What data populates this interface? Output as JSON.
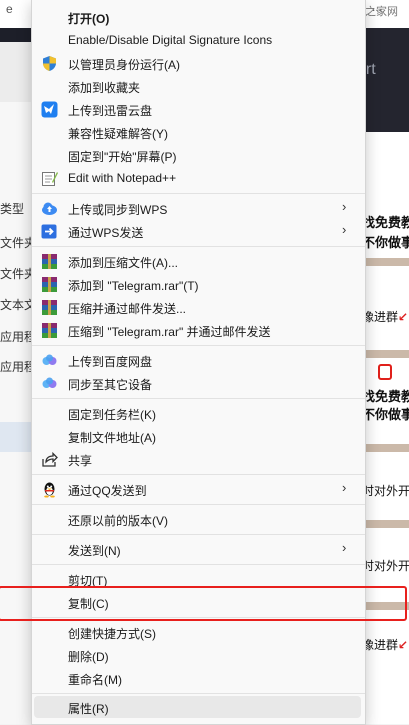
{
  "background": {
    "tab_ellipsis_1": "e",
    "tab_ellipsis_2": "...",
    "site_label": "才之家网",
    "dark_panel_text": "ort",
    "left_labels": [
      "类型",
      "文件夹",
      "文件夹",
      "文本文",
      "应用程",
      "应用程"
    ],
    "right_texts": [
      {
        "text": "找免费教",
        "bold": true
      },
      {
        "text": "不你做事",
        "bold": true
      },
      {
        "text": "像进群",
        "bold": false
      },
      {
        "text": "找免费教",
        "bold": true
      },
      {
        "text": "不你做事",
        "bold": true
      },
      {
        "text": "时对外开",
        "bold": false
      },
      {
        "text": "时对外开",
        "bold": false
      },
      {
        "text": "像进群",
        "bold": false
      }
    ],
    "arrow_glyph": "↙"
  },
  "menu": {
    "items": [
      {
        "id": "open",
        "label": "打开(O)",
        "icon": "",
        "bold": true
      },
      {
        "id": "sigicons",
        "label": "Enable/Disable Digital Signature Icons",
        "icon": ""
      },
      {
        "id": "runas",
        "label": "以管理员身份运行(A)",
        "icon": "uac-shield-icon"
      },
      {
        "id": "favorites",
        "label": "添加到收藏夹",
        "icon": ""
      },
      {
        "id": "xunlei",
        "label": "上传到迅雷云盘",
        "icon": "xunlei-bird-icon"
      },
      {
        "id": "compat",
        "label": "兼容性疑难解答(Y)",
        "icon": ""
      },
      {
        "id": "pinstart",
        "label": "固定到\"开始\"屏幕(P)",
        "icon": ""
      },
      {
        "id": "notepad",
        "label": "Edit with Notepad++",
        "icon": "notepad-plus-icon"
      },
      {
        "id": "wpssync",
        "label": "上传或同步到WPS",
        "icon": "wps-cloud-icon",
        "submenu": true
      },
      {
        "id": "wpssend",
        "label": "通过WPS发送",
        "icon": "wps-send-icon",
        "submenu": true
      },
      {
        "id": "rar1",
        "label": "添加到压缩文件(A)...",
        "icon": "winrar-icon"
      },
      {
        "id": "rar2",
        "label": "添加到 \"Telegram.rar\"(T)",
        "icon": "winrar-icon"
      },
      {
        "id": "rar3",
        "label": "压缩并通过邮件发送...",
        "icon": "winrar-icon"
      },
      {
        "id": "rar4",
        "label": "压缩到 \"Telegram.rar\" 并通过邮件发送",
        "icon": "winrar-icon"
      },
      {
        "id": "baidu",
        "label": "上传到百度网盘",
        "icon": "baidu-cloud-icon"
      },
      {
        "id": "syncdev",
        "label": "同步至其它设备",
        "icon": "baidu-cloud-icon"
      },
      {
        "id": "pintask",
        "label": "固定到任务栏(K)",
        "icon": ""
      },
      {
        "id": "copypath",
        "label": "复制文件地址(A)",
        "icon": ""
      },
      {
        "id": "share",
        "label": "共享",
        "icon": "share-icon"
      },
      {
        "id": "qq",
        "label": "通过QQ发送到",
        "icon": "qq-penguin-icon",
        "submenu": true
      },
      {
        "id": "restore",
        "label": "还原以前的版本(V)",
        "icon": ""
      },
      {
        "id": "sendto",
        "label": "发送到(N)",
        "icon": "",
        "submenu": true
      },
      {
        "id": "cut",
        "label": "剪切(T)",
        "icon": ""
      },
      {
        "id": "copy",
        "label": "复制(C)",
        "icon": ""
      },
      {
        "id": "shortcut",
        "label": "创建快捷方式(S)",
        "icon": ""
      },
      {
        "id": "delete",
        "label": "删除(D)",
        "icon": ""
      },
      {
        "id": "rename",
        "label": "重命名(M)",
        "icon": ""
      },
      {
        "id": "properties",
        "label": "属性(R)",
        "icon": ""
      }
    ],
    "submenu_arrow": "›",
    "highlighted_item": "properties"
  },
  "colors": {
    "annotation_red": "#e8201d",
    "menu_bg": "#f9f9f9"
  }
}
